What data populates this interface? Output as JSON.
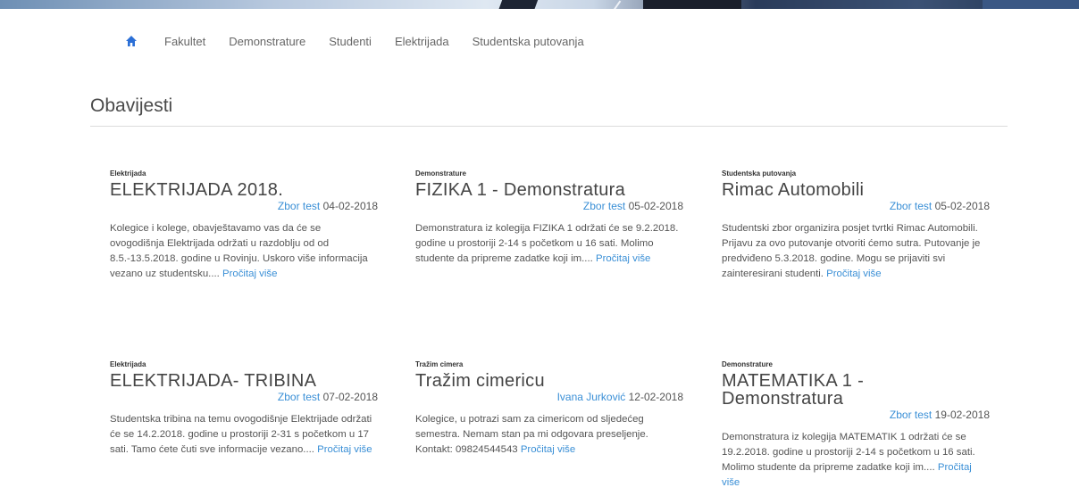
{
  "nav": {
    "home_icon": "home-icon",
    "items": [
      "Fakultet",
      "Demonstrature",
      "Studenti",
      "Elektrijada",
      "Studentska putovanja"
    ]
  },
  "section_title": "Obavijesti",
  "read_more": "Pročitaj više",
  "colors": {
    "accent": "#3a8fd6",
    "home_icon": "#2b6fd6"
  },
  "cards": [
    {
      "category": "Elektrijada",
      "title": "ELEKTRIJADA 2018.",
      "author": "Zbor test",
      "date": "04-02-2018",
      "excerpt": "Kolegice i kolege, obavještavamo vas da će se ovogodišnja Elektrijada održati u razdoblju od od 8.5.-13.5.2018. godine u Rovinju. Uskoro više informacija vezano uz studentsku...."
    },
    {
      "category": "Demonstrature",
      "title": "FIZIKA 1 - Demonstratura",
      "author": "Zbor test",
      "date": "05-02-2018",
      "excerpt": "Demonstratura iz kolegija FIZIKA 1 održati će se 9.2.2018. godine u prostoriji 2-14 s početkom u 16 sati. Molimo studente da pripreme zadatke koji im...."
    },
    {
      "category": "Studentska putovanja",
      "title": "Rimac Automobili",
      "author": "Zbor test",
      "date": "05-02-2018",
      "excerpt": "Studentski zbor organizira posjet tvrtki Rimac Automobili. Prijavu za ovo putovanje otvoriti ćemo sutra. Putovanje je predviđeno 5.3.2018. godine. Mogu se prijaviti svi zainteresirani studenti."
    },
    {
      "category": "Elektrijada",
      "title": "ELEKTRIJADA- TRIBINA",
      "author": "Zbor test",
      "date": "07-02-2018",
      "excerpt": "Studentska tribina na temu ovogodišnje Elektrijade održati će se 14.2.2018. godine u prostoriji 2-31 s početkom u 17 sati. Tamo ćete čuti sve informacije vezano...."
    },
    {
      "category": "Tražim cimera",
      "title": "Tražim cimericu",
      "author": "Ivana Jurković",
      "date": "12-02-2018",
      "excerpt": "Kolegice, u potrazi sam za cimericom od sljedećeg semestra. Nemam stan pa mi odgovara preseljenje. Kontakt: 09824544543"
    },
    {
      "category": "Demonstrature",
      "title": "MATEMATIKA 1 - Demonstratura",
      "author": "Zbor test",
      "date": "19-02-2018",
      "excerpt": "Demonstratura iz kolegija MATEMATIK 1 održati će se 19.2.2018. godine u prostoriji 2-14 s početkom u 16 sati. Molimo studente da pripreme zadatke koji im...."
    }
  ]
}
